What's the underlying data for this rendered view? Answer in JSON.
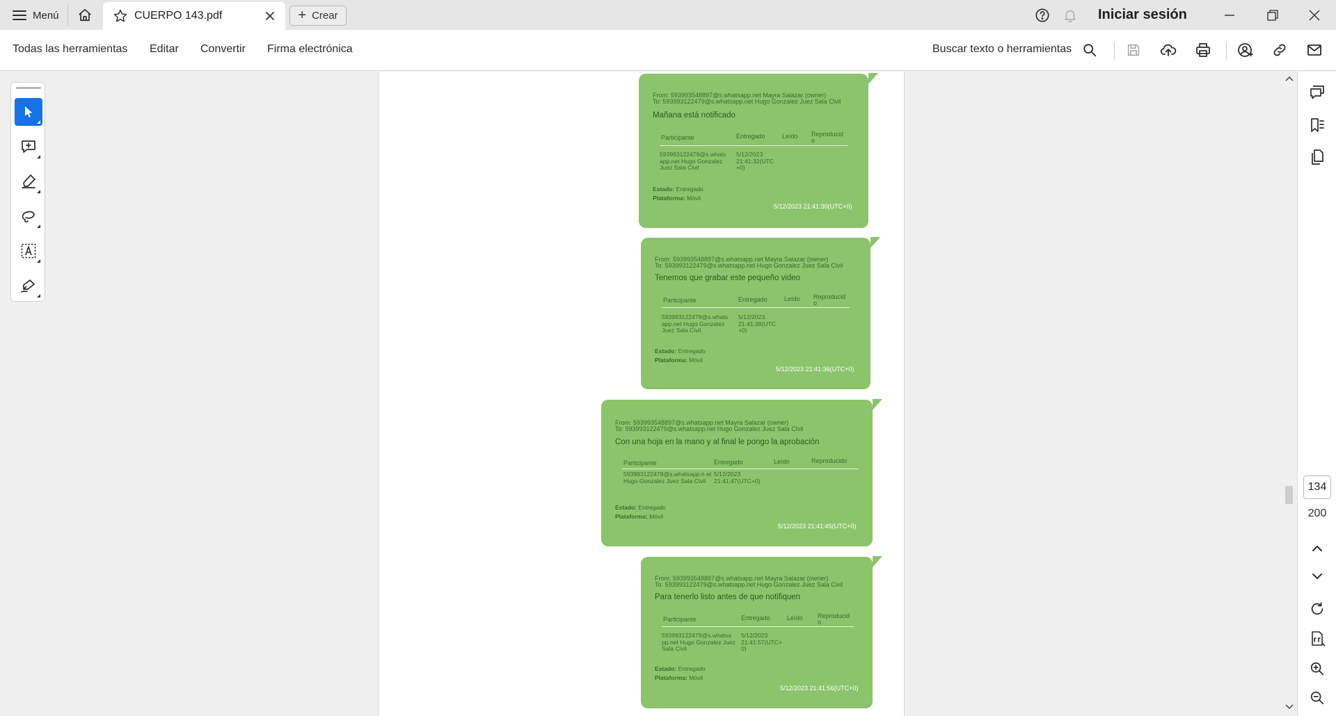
{
  "titlebar": {
    "menu_label": "Menú",
    "tab_title": "CUERPO 143.pdf",
    "create_label": "Crear",
    "signin_label": "Iniciar sesión"
  },
  "toolbar": {
    "all_tools": "Todas las herramientas",
    "edit": "Editar",
    "convert": "Convertir",
    "esign": "Firma electrónica",
    "search_placeholder": "Buscar texto o herramientas"
  },
  "left_rail": {
    "tools": [
      "select-tool",
      "add-comment-tool",
      "highlight-tool",
      "draw-tool",
      "text-select-tool",
      "sign-tool"
    ]
  },
  "navigation": {
    "current_page": "134",
    "total_pages": "200"
  },
  "messages": [
    {
      "from": "From: 593993548897@s.whatsapp.net Mayra Salazar (owner)",
      "to": "To: 593993122479@s.whatsapp.net Hugo Gonzalez Juez Sala Civil",
      "text": "Mañana está notificado",
      "headers": [
        "Participante",
        "Entregado",
        "Leído",
        "Reproducid o"
      ],
      "participant": "593993122479@s.whats app.net Hugo Gonzalez Juez Sala Civil",
      "delivered": "5/12/2023 21:41:32(UTC +0)",
      "status_label": "Estado:",
      "status": "Entregado",
      "platform_label": "Plataforma:",
      "platform": "Móvil",
      "timestamp": "5/12/2023 21:41:30(UTC+0)"
    },
    {
      "from": "From: 593993548897@s.whatsapp.net Mayra Salazar (owner)",
      "to": "To: 593993122479@s.whatsapp.net Hugo Gonzalez Juez Sala Civil",
      "text": "Tenemos que grabar este pequeño video",
      "headers": [
        "Participante",
        "Entregado",
        "Leído",
        "Reproducid o"
      ],
      "participant": "593993122479@s.whats app.net Hugo Gonzalez Juez Sala Civil",
      "delivered": "5/12/2023 21:41:38(UTC +0)",
      "status_label": "Estado:",
      "status": "Entregado",
      "platform_label": "Plataforma:",
      "platform": "Móvil",
      "timestamp": "5/12/2023 21:41:36(UTC+0)"
    },
    {
      "from": "From: 593993548897@s.whatsapp.net Mayra Salazar (owner)",
      "to": "To: 593993122479@s.whatsapp.net Hugo Gonzalez Juez Sala Civil",
      "text": "Con una hoja en la mano y al final le pongo la aprobación",
      "headers": [
        "Participante",
        "Entregado",
        "Leído",
        "Reproducido"
      ],
      "participant": "593993122479@s.whatsapp.n et Hugo Gonzalez Juez Sala Civil",
      "delivered": "5/12/2023 21:41:47(UTC+0)",
      "status_label": "Estado:",
      "status": "Entregado",
      "platform_label": "Plataforma:",
      "platform": "Móvil",
      "timestamp": "5/12/2023 21:41:45(UTC+0)"
    },
    {
      "from": "From: 593993548897@s.whatsapp.net Mayra Salazar (owner)",
      "to": "To: 593993122479@s.whatsapp.net Hugo Gonzalez Juez Sala Civil",
      "text": "Para tenerlo listo antes de que notifiquen",
      "headers": [
        "Participante",
        "Entregado",
        "Leído",
        "Reproducid o"
      ],
      "participant": "593993122479@s.whatsa pp.net Hugo Gonzalez Juez Sala Civil",
      "delivered": "5/12/2023 21:41:57(UTC+ 0)",
      "status_label": "Estado:",
      "status": "Entregado",
      "platform_label": "Plataforma:",
      "platform": "Móvil",
      "timestamp": "5/12/2023 21:41:56(UTC+0)"
    }
  ],
  "colors": {
    "accent": "#1473e6",
    "bubble": "#8cc46c",
    "page": "#ffffff",
    "workspace": "#f0f0f0"
  }
}
